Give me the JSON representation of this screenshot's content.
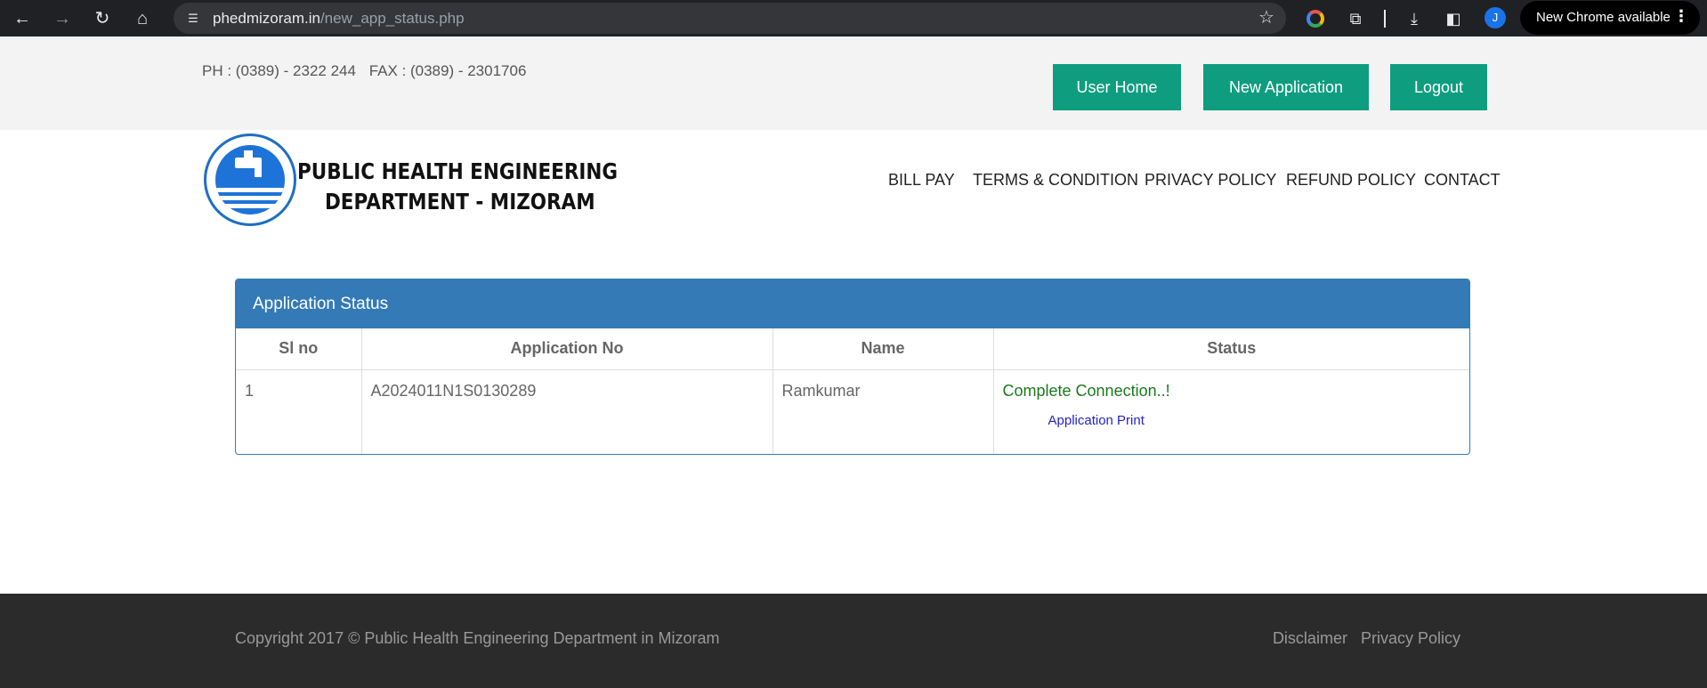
{
  "browser": {
    "url_host": "phedmizoram.in",
    "url_path": "/new_app_status.php",
    "avatar_letter": "J",
    "update_label": "New Chrome available"
  },
  "topbar": {
    "phone": "PH : (0389) - 2322 244",
    "fax": "FAX : (0389) - 2301706",
    "buttons": [
      "User Home",
      "New Application",
      "Logout"
    ]
  },
  "header": {
    "logo_line1": "PUBLIC HEALTH ENGINEERING",
    "logo_line2": "DEPARTMENT  - MIZORAM",
    "menu": [
      "BILL PAY",
      "TERMS & CONDITION",
      "PRIVACY POLICY",
      "REFUND POLICY",
      "CONTACT"
    ]
  },
  "panel": {
    "title": "Application Status",
    "columns": [
      "Sl no",
      "Application No",
      "Name",
      "Status"
    ],
    "rows": [
      {
        "sl_no": "1",
        "application_no": "A2024011N1S0130289",
        "name": "Ramkumar",
        "status": "Complete Connection..!",
        "print_link": "Application Print"
      }
    ]
  },
  "footer": {
    "copyright": "Copyright 2017 © Public Health Engineering Department in Mizoram",
    "links": [
      "Disclaimer",
      "Privacy Policy"
    ]
  },
  "colors": {
    "button_green": "#0f9d80",
    "panel_blue": "#337ab7",
    "status_green": "#1a7a1a",
    "link_blue": "#2222cc",
    "footer_dark": "#2b2b2c"
  }
}
